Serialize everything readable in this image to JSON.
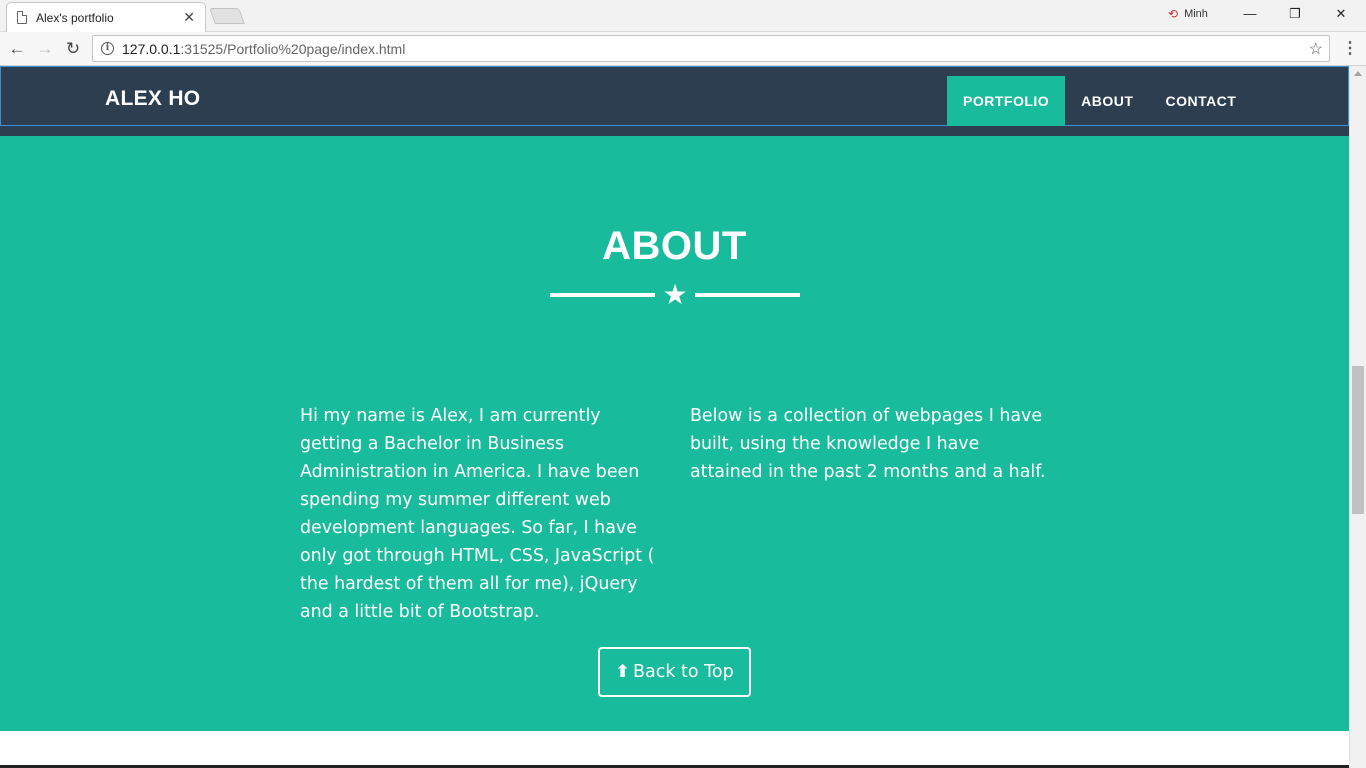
{
  "browser": {
    "tab_title": "Alex's portfolio",
    "tab_close": "✕",
    "profile_name": "Minh",
    "url_host": "127.0.0.1",
    "url_rest": ":31525/Portfolio%20page/index.html",
    "window_controls": {
      "minimize": "—",
      "restore": "❐",
      "close": "✕"
    },
    "nav": {
      "back": "←",
      "forward": "→",
      "reload": "↻",
      "menu": "⋮",
      "bookmark": "☆"
    }
  },
  "navbar": {
    "brand": "ALEX HO",
    "links": [
      {
        "label": "PORTFOLIO",
        "active": true
      },
      {
        "label": "ABOUT",
        "active": false
      },
      {
        "label": "CONTACT",
        "active": false
      }
    ]
  },
  "about": {
    "title": "ABOUT",
    "divider_icon": "★",
    "left_text": "Hi my name is Alex, I am currently getting a Bachelor in Business Administration in America. I have been spending my summer different web development languages. So far, I have only got through HTML, CSS, JavaScript ( the hardest of them all for me), jQuery and a little bit of Bootstrap.",
    "right_text": "Below is a collection of webpages I have built, using the knowledge I have attained in the past 2 months and a half.",
    "button_label": "Back to Top",
    "button_icon": "⬆"
  },
  "colors": {
    "navbar_bg": "#2c3e50",
    "accent": "#18bc9c",
    "text": "#ffffff"
  }
}
